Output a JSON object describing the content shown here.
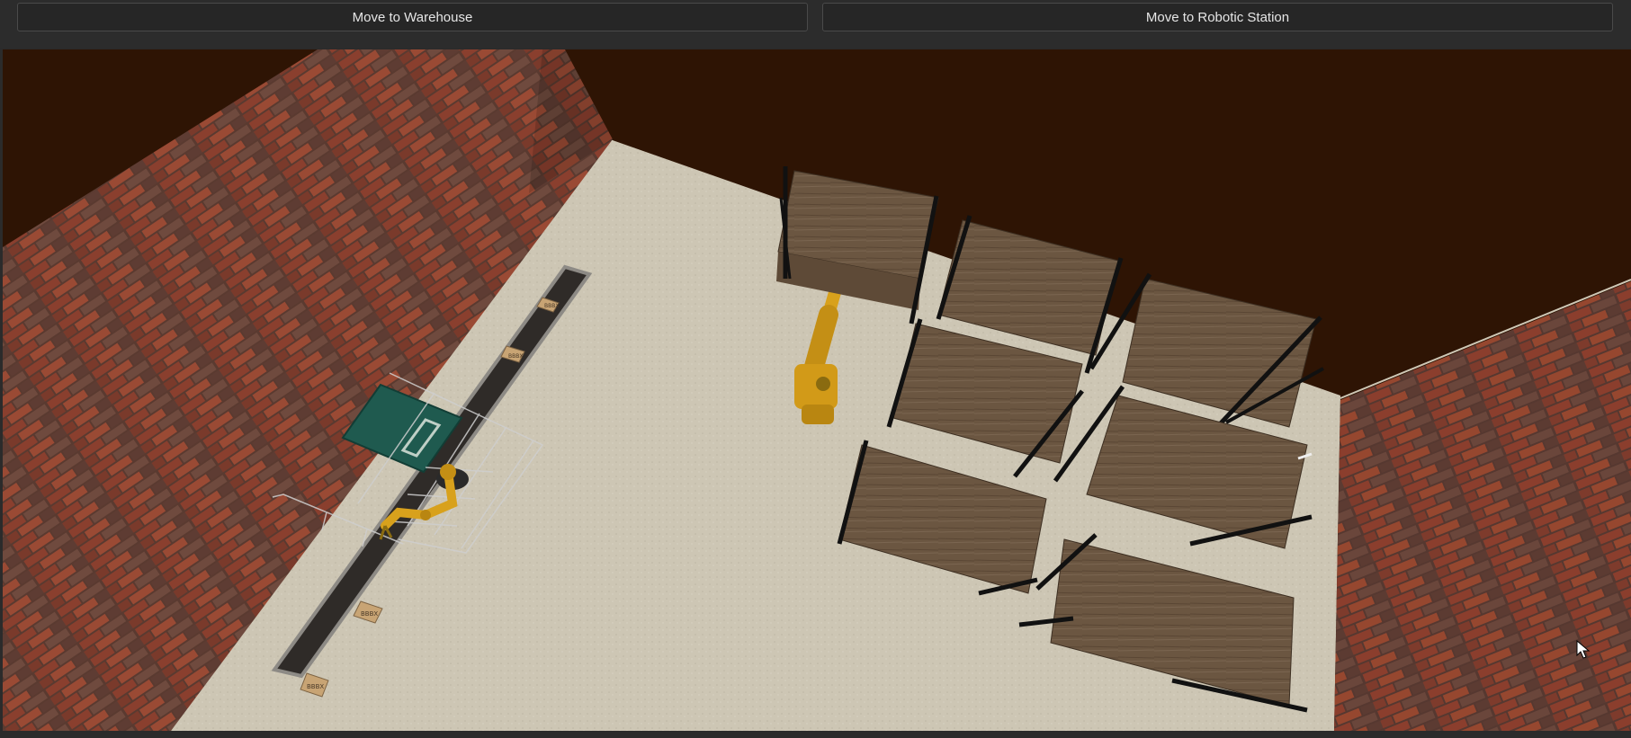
{
  "toolbar": {
    "warehouse_button_label": "Move to Warehouse",
    "robotic_station_button_label": "Move to Robotic Station"
  },
  "scene": {
    "box_label": "BBBX",
    "colors": {
      "ceiling": "#2e1404",
      "floor": "#cfc8b6",
      "brick": "#7a3b2c",
      "shelf_wood": "#6f5a44",
      "robot": "#d8a11c",
      "conveyor": "#3a3632",
      "box": "#c8a474",
      "mat": "#1f5a4f"
    },
    "icons": [
      "robot-arm-icon",
      "shelf-icon",
      "conveyor-icon",
      "box-icon",
      "mouse-cursor-icon"
    ]
  }
}
